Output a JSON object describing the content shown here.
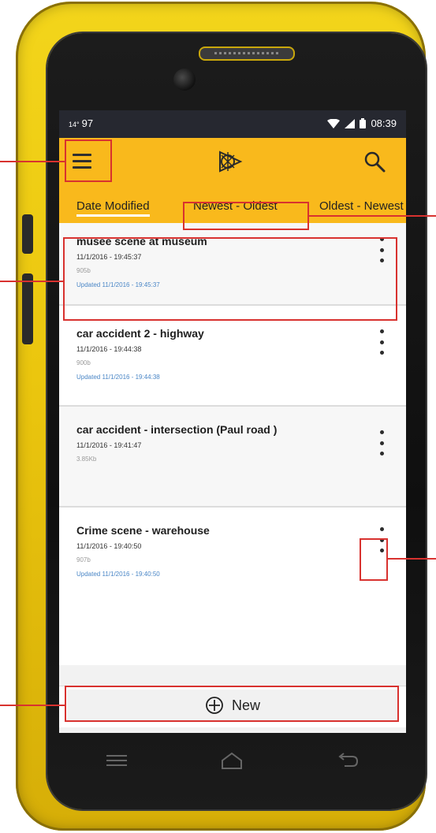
{
  "statusbar": {
    "left_small": "14°",
    "left_value": "97",
    "time": "08:39"
  },
  "appbar": {
    "menu_icon": "hamburger-menu-icon",
    "logo_icon": "app-logo-icon",
    "search_icon": "search-icon"
  },
  "tabs": {
    "sort_field": "Date Modified",
    "order_active": "Newest - Oldest",
    "order_other": "Oldest - Newest"
  },
  "scenes": [
    {
      "title": "musee scene at museum",
      "date": "11/1/2016 - 19:45:37",
      "size": "905b",
      "updated": "Updated 11/1/2016 - 19:45:37"
    },
    {
      "title": "car accident 2 - highway",
      "date": "11/1/2016 - 19:44:38",
      "size": "900b",
      "updated": "Updated 11/1/2016 - 19:44:38"
    },
    {
      "title": "car accident - intersection (Paul road )",
      "date": "11/1/2016 - 19:41:47",
      "size": "3.85Kb",
      "updated": ""
    },
    {
      "title": "Crime scene - warehouse",
      "date": "11/1/2016 - 19:40:50",
      "size": "907b",
      "updated": "Updated 11/1/2016 - 19:40:50"
    }
  ],
  "new_button": {
    "label": "New",
    "icon": "add-circle-icon"
  },
  "navbar": {
    "recent_icon": "recent-apps-icon",
    "home_icon": "home-icon",
    "back_icon": "back-icon"
  },
  "colors": {
    "accent": "#f9b91c",
    "callout": "#d8322f",
    "device_yellow": "#ebc60e",
    "updated_text": "#4a86c6"
  }
}
